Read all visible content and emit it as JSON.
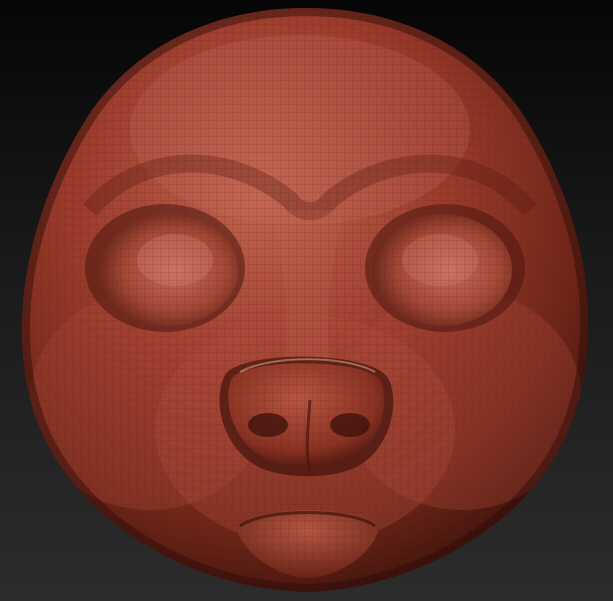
{
  "viewport": {
    "background_top": "#060606",
    "background_bottom": "#2c2c2c"
  },
  "model": {
    "subject": "sculpted-head-mesh",
    "material_base": "#9a3a2a",
    "material_highlight": "#d0735f",
    "material_shadow": "#4a1710",
    "wireframe_color": "#5a1e14",
    "wireframe_visible": true
  }
}
